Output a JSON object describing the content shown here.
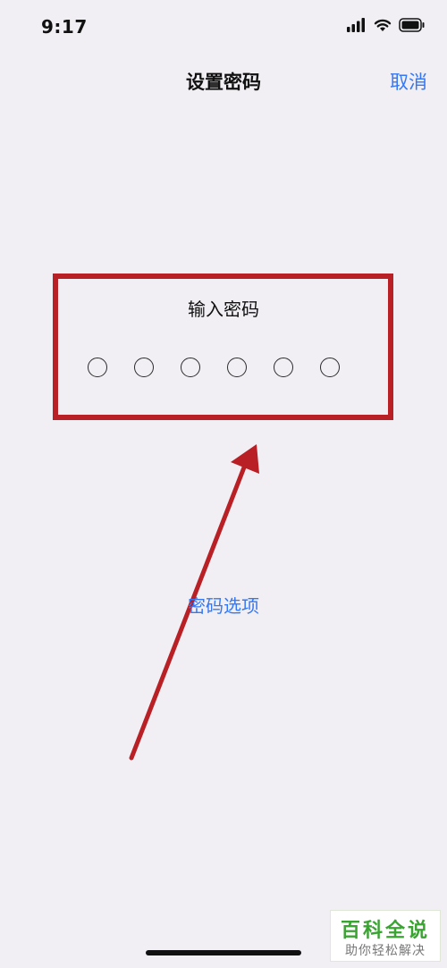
{
  "status_bar": {
    "time": "9:17",
    "icons": [
      "signal-icon",
      "wifi-icon",
      "battery-icon"
    ]
  },
  "nav": {
    "title": "设置密码",
    "cancel_label": "取消"
  },
  "passcode": {
    "prompt": "输入密码",
    "digit_count": 6,
    "entered_digits": 0
  },
  "options_label": "密码选项",
  "annotation": {
    "highlight_color": "#b82025",
    "arrow_color": "#b82025"
  },
  "watermark": {
    "title": "百科全说",
    "subtitle": "助你轻松解决"
  },
  "colors": {
    "background": "#f1eff4",
    "accent": "#3478f6"
  }
}
